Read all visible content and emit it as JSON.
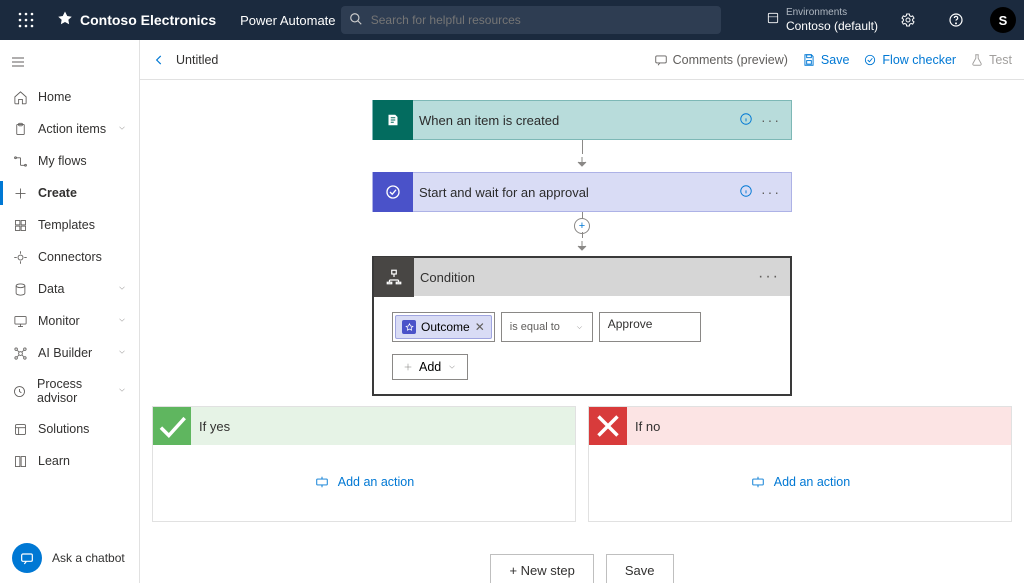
{
  "header": {
    "brand": "Contoso Electronics",
    "service": "Power Automate",
    "search_placeholder": "Search for helpful resources",
    "env_label": "Environments",
    "env_name": "Contoso (default)",
    "avatar_initial": "S"
  },
  "sidebar": {
    "items": [
      {
        "label": "Home",
        "chevron": false
      },
      {
        "label": "Action items",
        "chevron": true
      },
      {
        "label": "My flows",
        "chevron": false
      },
      {
        "label": "Create",
        "chevron": false
      },
      {
        "label": "Templates",
        "chevron": false
      },
      {
        "label": "Connectors",
        "chevron": false
      },
      {
        "label": "Data",
        "chevron": true
      },
      {
        "label": "Monitor",
        "chevron": true
      },
      {
        "label": "AI Builder",
        "chevron": true
      },
      {
        "label": "Process advisor",
        "chevron": true
      },
      {
        "label": "Solutions",
        "chevron": false
      },
      {
        "label": "Learn",
        "chevron": false
      }
    ],
    "active_index": 3,
    "chatbot_label": "Ask a chatbot"
  },
  "cmdbar": {
    "title": "Untitled",
    "comments": "Comments (preview)",
    "save": "Save",
    "checker": "Flow checker",
    "test": "Test"
  },
  "flow": {
    "trigger": {
      "title": "When an item is created"
    },
    "action1": {
      "title": "Start and wait for an approval"
    },
    "condition": {
      "title": "Condition",
      "token": "Outcome",
      "operator": "is equal to",
      "value": "Approve",
      "add_label": "Add"
    },
    "branches": {
      "yes_label": "If yes",
      "no_label": "If no",
      "add_action": "Add an action"
    },
    "new_step": "+ New step",
    "save_btn": "Save"
  }
}
